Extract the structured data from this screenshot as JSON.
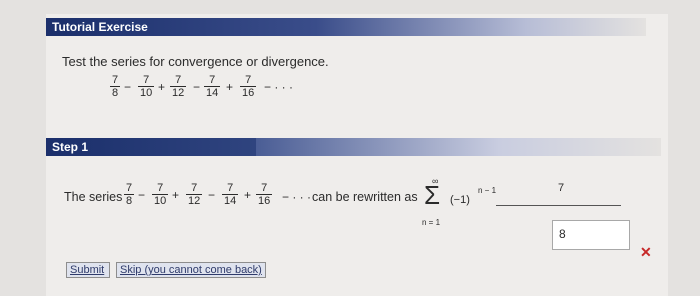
{
  "header": {
    "title": "Tutorial Exercise"
  },
  "prompt": {
    "text": "Test the series for convergence or divergence."
  },
  "series": {
    "numerator": "7",
    "denominators": [
      "8",
      "10",
      "12",
      "14",
      "16"
    ],
    "operators": [
      "−",
      "+",
      "−",
      "+",
      "− · · ·"
    ]
  },
  "step": {
    "label": "Step 1",
    "lead_text": "The series",
    "rewrite_text": "can be rewritten as",
    "sum_upper": "∞",
    "sum_lower": "n = 1",
    "sum_symbol": "Σ",
    "sum_term": "(−1)",
    "sum_exponent": "n − 1",
    "rhs_numerator": "7",
    "answer_value": "8",
    "status_icon": "x-mark-icon"
  },
  "buttons": {
    "submit": "Submit",
    "skip": "Skip (you cannot come back)"
  }
}
